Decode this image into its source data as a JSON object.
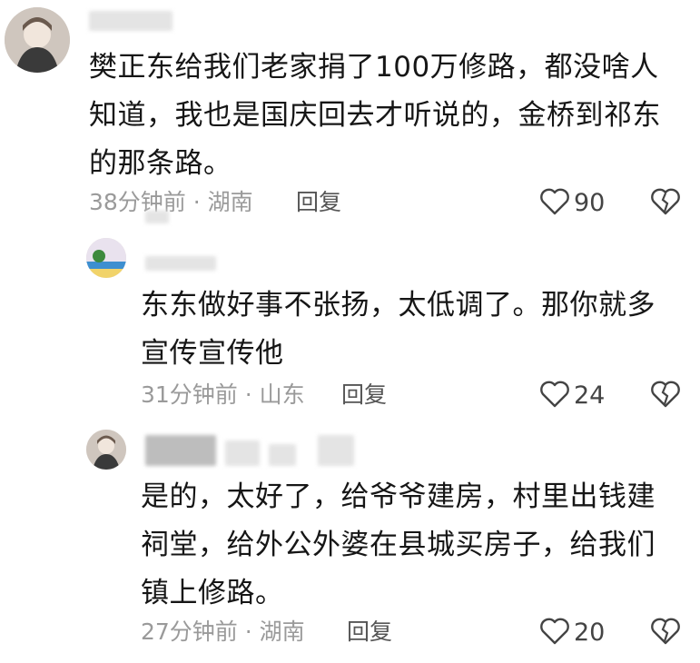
{
  "comments": [
    {
      "username": "",
      "text": "樊正东给我们老家捐了100万修路，都没啥人知道，我也是国庆回去才听说的，金桥到祁东的那条路。",
      "meta": "38分钟前 · 湖南",
      "reply_label": "回复",
      "likes": "90",
      "avatar_icon": "user-avatar-photo"
    },
    {
      "username": "",
      "text": "东东做好事不张扬，太低调了。那你就多宣传宣传他",
      "meta": "31分钟前 · 山东",
      "reply_label": "回复",
      "likes": "24",
      "avatar_icon": "user-avatar-landscape"
    },
    {
      "username": "",
      "text": "是的，太好了，给爷爷建房，村里出钱建祠堂，给外公外婆在县城买房子，给我们镇上修路。",
      "meta": "27分钟前 · 湖南",
      "reply_label": "回复",
      "likes": "20",
      "avatar_icon": "user-avatar-photo"
    }
  ],
  "icons": {
    "like": "heart-outline-icon",
    "dislike": "broken-heart-icon"
  },
  "colors": {
    "text": "#161616",
    "meta": "#9a9a9a",
    "reply": "#555555"
  }
}
